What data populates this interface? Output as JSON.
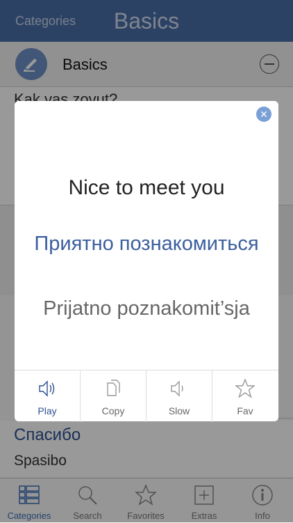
{
  "header": {
    "back_label": "Categories",
    "title": "Basics"
  },
  "section": {
    "label": "Basics"
  },
  "list": {
    "peek_phrase": "Kak vas zovut?",
    "item": {
      "native": "Спасибо",
      "roman": "Spasibo"
    }
  },
  "modal": {
    "english": "Nice to meet you",
    "native": "Приятно познакомиться",
    "roman": "Prijatno poznakomit’sja",
    "actions": {
      "play": "Play",
      "copy": "Copy",
      "slow": "Slow",
      "fav": "Fav"
    }
  },
  "tabbar": {
    "categories": "Categories",
    "search": "Search",
    "favorites": "Favorites",
    "extras": "Extras",
    "info": "Info"
  },
  "colors": {
    "header_bg": "#4a6fa8",
    "accent": "#3b5e9d",
    "tab_active": "#3b6fb6"
  }
}
